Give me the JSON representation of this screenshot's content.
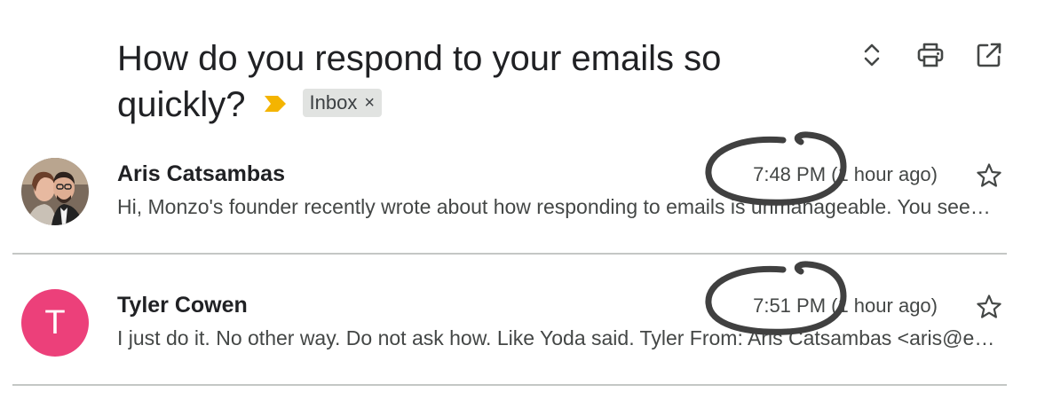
{
  "thread": {
    "subject_line1": "How do you respond to your emails so",
    "subject_line2": "quickly?",
    "label": "Inbox",
    "label_remove": "×",
    "importance_color": "#f4b400"
  },
  "toolbar": {
    "icons": [
      "expand-collapse-icon",
      "print-icon",
      "open-in-new-window-icon"
    ]
  },
  "messages": [
    {
      "sender": "Aris Catsambas",
      "time": "7:48 PM (1 hour ago)",
      "snippet": "Hi, Monzo's founder recently wrote about how responding to emails is unmanageable. You seem to respond to all emails very quickly, how do you do it?",
      "avatar": "photo",
      "starred": false
    },
    {
      "sender": "Tyler Cowen",
      "time": "7:51 PM (1 hour ago)",
      "snippet": "I just do it. No other way. Do not ask how. Like Yoda said. Tyler From: Aris Catsambas <aris@example.com>",
      "avatar": "T",
      "avatar_color": "#ec407a",
      "starred": false
    }
  ],
  "annotation_color": "#404040"
}
